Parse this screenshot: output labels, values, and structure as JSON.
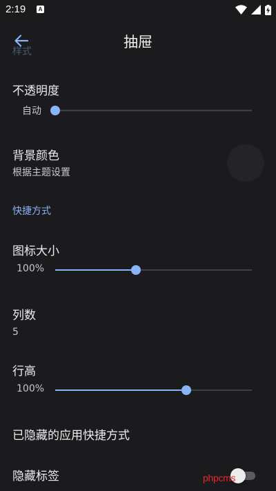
{
  "status_bar": {
    "time": "2:19",
    "notification_glyph": "A"
  },
  "app_bar": {
    "title": "抽屉",
    "back_icon": "arrow-back-icon"
  },
  "hidden_section_label": "样式",
  "opacity": {
    "title": "不透明度",
    "slider_label": "自动",
    "value_percent": 0
  },
  "background_color": {
    "title": "背景颜色",
    "summary": "根据主题设置",
    "swatch_color": "#242426"
  },
  "shortcuts_header": "快捷方式",
  "icon_size": {
    "title": "图标大小",
    "slider_label": "100%",
    "value_fraction": 0.41
  },
  "columns": {
    "title": "列数",
    "summary": "5"
  },
  "row_height": {
    "title": "行高",
    "slider_label": "100%",
    "value_fraction": 0.665
  },
  "hidden_apps": {
    "title": "已隐藏的应用快捷方式"
  },
  "hide_labels": {
    "title": "隐藏标签",
    "enabled": false
  },
  "watermark": "phpcms",
  "colors": {
    "background": "#1b1b1d",
    "accent": "#8ab4f8",
    "track": "#3a4252",
    "watermark": "#e8262b"
  }
}
